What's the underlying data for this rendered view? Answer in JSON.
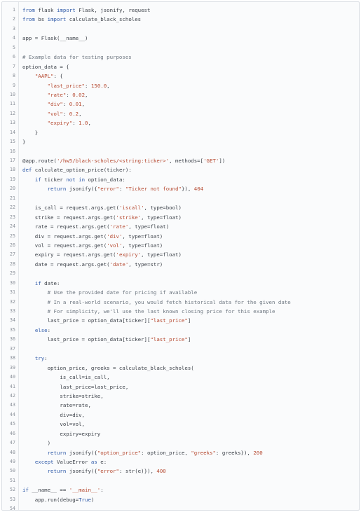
{
  "editor": {
    "language": "python",
    "colors": {
      "keyword": "#2f5aa8",
      "string": "#b5482f",
      "number": "#b5482f",
      "comment": "#6e7781",
      "text": "#3b4048",
      "line_number": "#8a9099"
    },
    "lines": [
      {
        "n": "1",
        "tokens": [
          {
            "t": "from",
            "c": "kw"
          },
          {
            "t": " flask "
          },
          {
            "t": "import",
            "c": "kw"
          },
          {
            "t": " Flask, jsonify, request"
          }
        ]
      },
      {
        "n": "2",
        "tokens": [
          {
            "t": "from",
            "c": "kw"
          },
          {
            "t": " bs "
          },
          {
            "t": "import",
            "c": "kw"
          },
          {
            "t": " calculate_black_scholes"
          }
        ]
      },
      {
        "n": "3",
        "tokens": []
      },
      {
        "n": "4",
        "tokens": [
          {
            "t": "app = Flask(__name__)"
          }
        ]
      },
      {
        "n": "5",
        "tokens": []
      },
      {
        "n": "6",
        "tokens": [
          {
            "t": "# Example data for testing purposes",
            "c": "cm"
          }
        ]
      },
      {
        "n": "7",
        "tokens": [
          {
            "t": "option_data = {"
          }
        ]
      },
      {
        "n": "8",
        "tokens": [
          {
            "t": "    "
          },
          {
            "t": "\"AAPL\"",
            "c": "str"
          },
          {
            "t": ": {"
          }
        ]
      },
      {
        "n": "9",
        "tokens": [
          {
            "t": "        "
          },
          {
            "t": "\"last_price\"",
            "c": "str"
          },
          {
            "t": ": "
          },
          {
            "t": "150.0",
            "c": "num"
          },
          {
            "t": ","
          }
        ]
      },
      {
        "n": "10",
        "tokens": [
          {
            "t": "        "
          },
          {
            "t": "\"rate\"",
            "c": "str"
          },
          {
            "t": ": "
          },
          {
            "t": "0.02",
            "c": "num"
          },
          {
            "t": ","
          }
        ]
      },
      {
        "n": "11",
        "tokens": [
          {
            "t": "        "
          },
          {
            "t": "\"div\"",
            "c": "str"
          },
          {
            "t": ": "
          },
          {
            "t": "0.01",
            "c": "num"
          },
          {
            "t": ","
          }
        ]
      },
      {
        "n": "12",
        "tokens": [
          {
            "t": "        "
          },
          {
            "t": "\"vol\"",
            "c": "str"
          },
          {
            "t": ": "
          },
          {
            "t": "0.2",
            "c": "num"
          },
          {
            "t": ","
          }
        ]
      },
      {
        "n": "13",
        "tokens": [
          {
            "t": "        "
          },
          {
            "t": "\"expiry\"",
            "c": "str"
          },
          {
            "t": ": "
          },
          {
            "t": "1.0",
            "c": "num"
          },
          {
            "t": ","
          }
        ]
      },
      {
        "n": "14",
        "tokens": [
          {
            "t": "    }"
          }
        ]
      },
      {
        "n": "15",
        "tokens": [
          {
            "t": "}"
          }
        ]
      },
      {
        "n": "16",
        "tokens": []
      },
      {
        "n": "17",
        "tokens": [
          {
            "t": "@app.route("
          },
          {
            "t": "'/hw5/black-scholes/<string:ticker>'",
            "c": "str"
          },
          {
            "t": ", methods=["
          },
          {
            "t": "'GET'",
            "c": "str"
          },
          {
            "t": "])"
          }
        ]
      },
      {
        "n": "18",
        "tokens": [
          {
            "t": "def",
            "c": "kw"
          },
          {
            "t": " calculate_option_price(ticker):"
          }
        ]
      },
      {
        "n": "19",
        "tokens": [
          {
            "t": "    "
          },
          {
            "t": "if",
            "c": "kw"
          },
          {
            "t": " ticker "
          },
          {
            "t": "not in",
            "c": "kw"
          },
          {
            "t": " option_data:"
          }
        ]
      },
      {
        "n": "20",
        "tokens": [
          {
            "t": "        "
          },
          {
            "t": "return",
            "c": "kw"
          },
          {
            "t": " jsonify({"
          },
          {
            "t": "\"error\"",
            "c": "str"
          },
          {
            "t": ": "
          },
          {
            "t": "\"Ticker not found\"",
            "c": "str"
          },
          {
            "t": "}), "
          },
          {
            "t": "404",
            "c": "num"
          }
        ]
      },
      {
        "n": "21",
        "tokens": []
      },
      {
        "n": "22",
        "tokens": [
          {
            "t": "    is_call = request.args.get("
          },
          {
            "t": "'iscall'",
            "c": "str"
          },
          {
            "t": ", type=bool)"
          }
        ]
      },
      {
        "n": "23",
        "tokens": [
          {
            "t": "    strike = request.args.get("
          },
          {
            "t": "'strike'",
            "c": "str"
          },
          {
            "t": ", type=float)"
          }
        ]
      },
      {
        "n": "24",
        "tokens": [
          {
            "t": "    rate = request.args.get("
          },
          {
            "t": "'rate'",
            "c": "str"
          },
          {
            "t": ", type=float)"
          }
        ]
      },
      {
        "n": "25",
        "tokens": [
          {
            "t": "    div = request.args.get("
          },
          {
            "t": "'div'",
            "c": "str"
          },
          {
            "t": ", type=float)"
          }
        ]
      },
      {
        "n": "26",
        "tokens": [
          {
            "t": "    vol = request.args.get("
          },
          {
            "t": "'vol'",
            "c": "str"
          },
          {
            "t": ", type=float)"
          }
        ]
      },
      {
        "n": "27",
        "tokens": [
          {
            "t": "    expiry = request.args.get("
          },
          {
            "t": "'expiry'",
            "c": "str"
          },
          {
            "t": ", type=float)"
          }
        ]
      },
      {
        "n": "28",
        "tokens": [
          {
            "t": "    date = request.args.get("
          },
          {
            "t": "'date'",
            "c": "str"
          },
          {
            "t": ", type=str)"
          }
        ]
      },
      {
        "n": "29",
        "tokens": []
      },
      {
        "n": "30",
        "tokens": [
          {
            "t": "    "
          },
          {
            "t": "if",
            "c": "kw"
          },
          {
            "t": " date:"
          }
        ]
      },
      {
        "n": "31",
        "tokens": [
          {
            "t": "        "
          },
          {
            "t": "# Use the provided date for pricing if available",
            "c": "cm"
          }
        ]
      },
      {
        "n": "32",
        "tokens": [
          {
            "t": "        "
          },
          {
            "t": "# In a real-world scenario, you would fetch historical data for the given date",
            "c": "cm"
          }
        ]
      },
      {
        "n": "33",
        "tokens": [
          {
            "t": "        "
          },
          {
            "t": "# For simplicity, we'll use the last known closing price for this example",
            "c": "cm"
          }
        ]
      },
      {
        "n": "34",
        "tokens": [
          {
            "t": "        last_price = option_data[ticker]["
          },
          {
            "t": "\"last_price\"",
            "c": "str"
          },
          {
            "t": "]"
          }
        ]
      },
      {
        "n": "35",
        "tokens": [
          {
            "t": "    "
          },
          {
            "t": "else",
            "c": "kw"
          },
          {
            "t": ":"
          }
        ]
      },
      {
        "n": "36",
        "tokens": [
          {
            "t": "        last_price = option_data[ticker]["
          },
          {
            "t": "\"last_price\"",
            "c": "str"
          },
          {
            "t": "]"
          }
        ]
      },
      {
        "n": "37",
        "tokens": []
      },
      {
        "n": "38",
        "tokens": [
          {
            "t": "    "
          },
          {
            "t": "try",
            "c": "kw"
          },
          {
            "t": ":"
          }
        ]
      },
      {
        "n": "39",
        "tokens": [
          {
            "t": "        option_price, greeks = calculate_black_scholes("
          }
        ]
      },
      {
        "n": "40",
        "tokens": [
          {
            "t": "            is_call=is_call,"
          }
        ]
      },
      {
        "n": "41",
        "tokens": [
          {
            "t": "            last_price=last_price,"
          }
        ]
      },
      {
        "n": "42",
        "tokens": [
          {
            "t": "            strike=strike,"
          }
        ]
      },
      {
        "n": "43",
        "tokens": [
          {
            "t": "            rate=rate,"
          }
        ]
      },
      {
        "n": "44",
        "tokens": [
          {
            "t": "            div=div,"
          }
        ]
      },
      {
        "n": "45",
        "tokens": [
          {
            "t": "            vol=vol,"
          }
        ]
      },
      {
        "n": "46",
        "tokens": [
          {
            "t": "            expiry=expiry"
          }
        ]
      },
      {
        "n": "47",
        "tokens": [
          {
            "t": "        )"
          }
        ]
      },
      {
        "n": "48",
        "tokens": [
          {
            "t": "        "
          },
          {
            "t": "return",
            "c": "kw"
          },
          {
            "t": " jsonify({"
          },
          {
            "t": "\"option_price\"",
            "c": "str"
          },
          {
            "t": ": option_price, "
          },
          {
            "t": "\"greeks\"",
            "c": "str"
          },
          {
            "t": ": greeks}), "
          },
          {
            "t": "200",
            "c": "num"
          }
        ]
      },
      {
        "n": "49",
        "tokens": [
          {
            "t": "    "
          },
          {
            "t": "except",
            "c": "kw"
          },
          {
            "t": " ValueError "
          },
          {
            "t": "as",
            "c": "kw"
          },
          {
            "t": " e:"
          }
        ]
      },
      {
        "n": "50",
        "tokens": [
          {
            "t": "        "
          },
          {
            "t": "return",
            "c": "kw"
          },
          {
            "t": " jsonify({"
          },
          {
            "t": "\"error\"",
            "c": "str"
          },
          {
            "t": ": str(e)}), "
          },
          {
            "t": "400",
            "c": "num"
          }
        ]
      },
      {
        "n": "51",
        "tokens": []
      },
      {
        "n": "52",
        "tokens": [
          {
            "t": "if",
            "c": "kw"
          },
          {
            "t": " __name__ == "
          },
          {
            "t": "'__main__'",
            "c": "str"
          },
          {
            "t": ":"
          }
        ]
      },
      {
        "n": "53",
        "tokens": [
          {
            "t": "    app.run(debug="
          },
          {
            "t": "True",
            "c": "kw"
          },
          {
            "t": ")"
          }
        ]
      },
      {
        "n": "54",
        "tokens": []
      }
    ]
  }
}
